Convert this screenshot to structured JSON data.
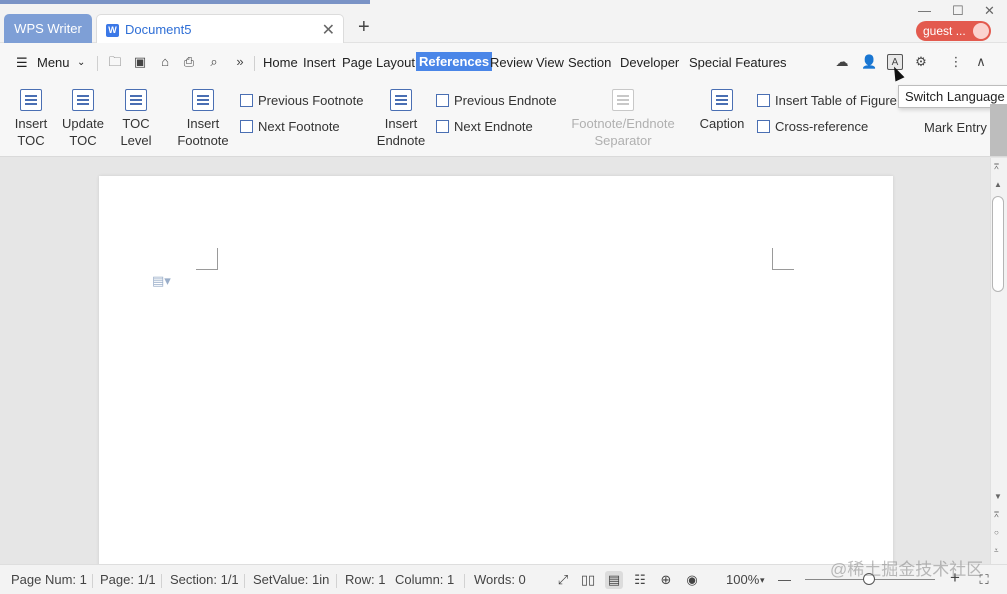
{
  "app": {
    "app_tab": "WPS Writer",
    "doc_tab": "Document5",
    "new_tab": "+",
    "user": "guest ..."
  },
  "menubar": {
    "menu_label": "Menu",
    "tabs": [
      "Home",
      "Insert",
      "Page Layout",
      "References",
      "Review",
      "View",
      "Section",
      "Developer",
      "Special Features"
    ],
    "active_tab": "References",
    "icons": [
      "folder-open-icon",
      "save-icon",
      "undo-format-icon",
      "print-icon",
      "print-preview-icon",
      "more-icon",
      "cloud-icon",
      "share-user-icon",
      "switch-language-icon",
      "settings-icon",
      "kebab-icon",
      "collapse-icon"
    ]
  },
  "ribbon": {
    "insert_toc": "Insert TOC",
    "update_toc": "Update TOC",
    "toc_level": "TOC Level",
    "insert_footnote": "Insert Footnote",
    "previous_footnote": "Previous Footnote",
    "next_footnote": "Next Footnote",
    "insert_endnote": "Insert Endnote",
    "previous_endnote": "Previous Endnote",
    "next_endnote": "Next Endnote",
    "separator": "Footnote/Endnote Separator",
    "caption": "Caption",
    "insert_table_of_figures": "Insert Table of Figure",
    "cross_reference": "Cross-reference",
    "mark_entry": "Mark Entry"
  },
  "tooltip": {
    "text": "Switch Language"
  },
  "statusbar": {
    "page_num": "Page Num: 1",
    "page": "Page: 1/1",
    "section": "Section: 1/1",
    "setvalue": "SetValue: 1in",
    "row": "Row: 1",
    "column": "Column: 1",
    "words": "Words: 0",
    "zoom": "100%",
    "zoom_minus": "—",
    "zoom_plus": "+"
  },
  "watermark": "@稀土掘金技术社区"
}
